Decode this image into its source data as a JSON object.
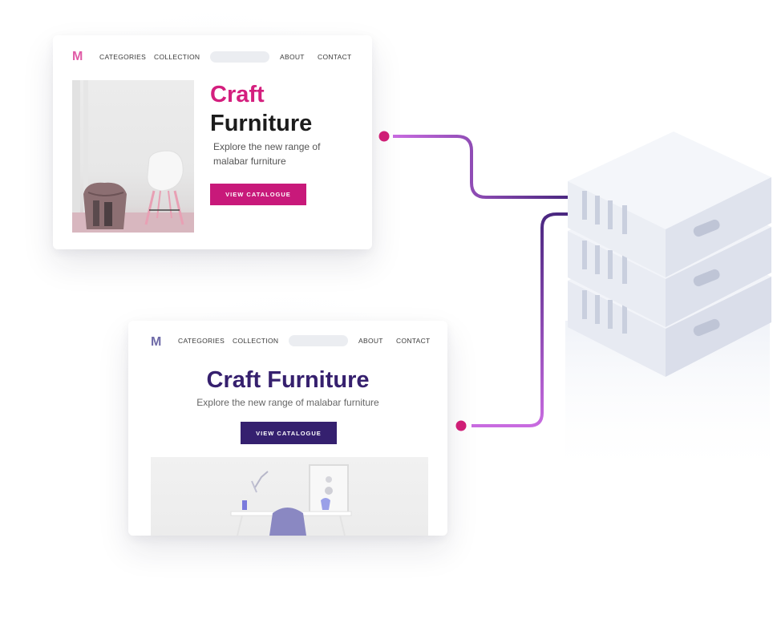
{
  "card1": {
    "logo": "M",
    "nav": [
      "CATEGORIES",
      "COLLECTION",
      "ABOUT",
      "CONTACT"
    ],
    "title_line1": "Craft",
    "title_line2": "Furniture",
    "subtitle": "Explore the new range of malabar furniture",
    "button": "VIEW CATALOGUE"
  },
  "card2": {
    "logo": "M",
    "nav": [
      "CATEGORIES",
      "COLLECTION",
      "ABOUT",
      "CONTACT"
    ],
    "title": "Craft Furniture",
    "subtitle": "Explore the new range of malabar furniture",
    "button": "VIEW CATALOGUE"
  },
  "colors": {
    "accent_pink": "#c8197a",
    "accent_purple": "#35206f",
    "connector_start": "#5a2a8a",
    "connector_end": "#c86be0"
  },
  "icons": [
    "server-icon",
    "logo-icon"
  ]
}
